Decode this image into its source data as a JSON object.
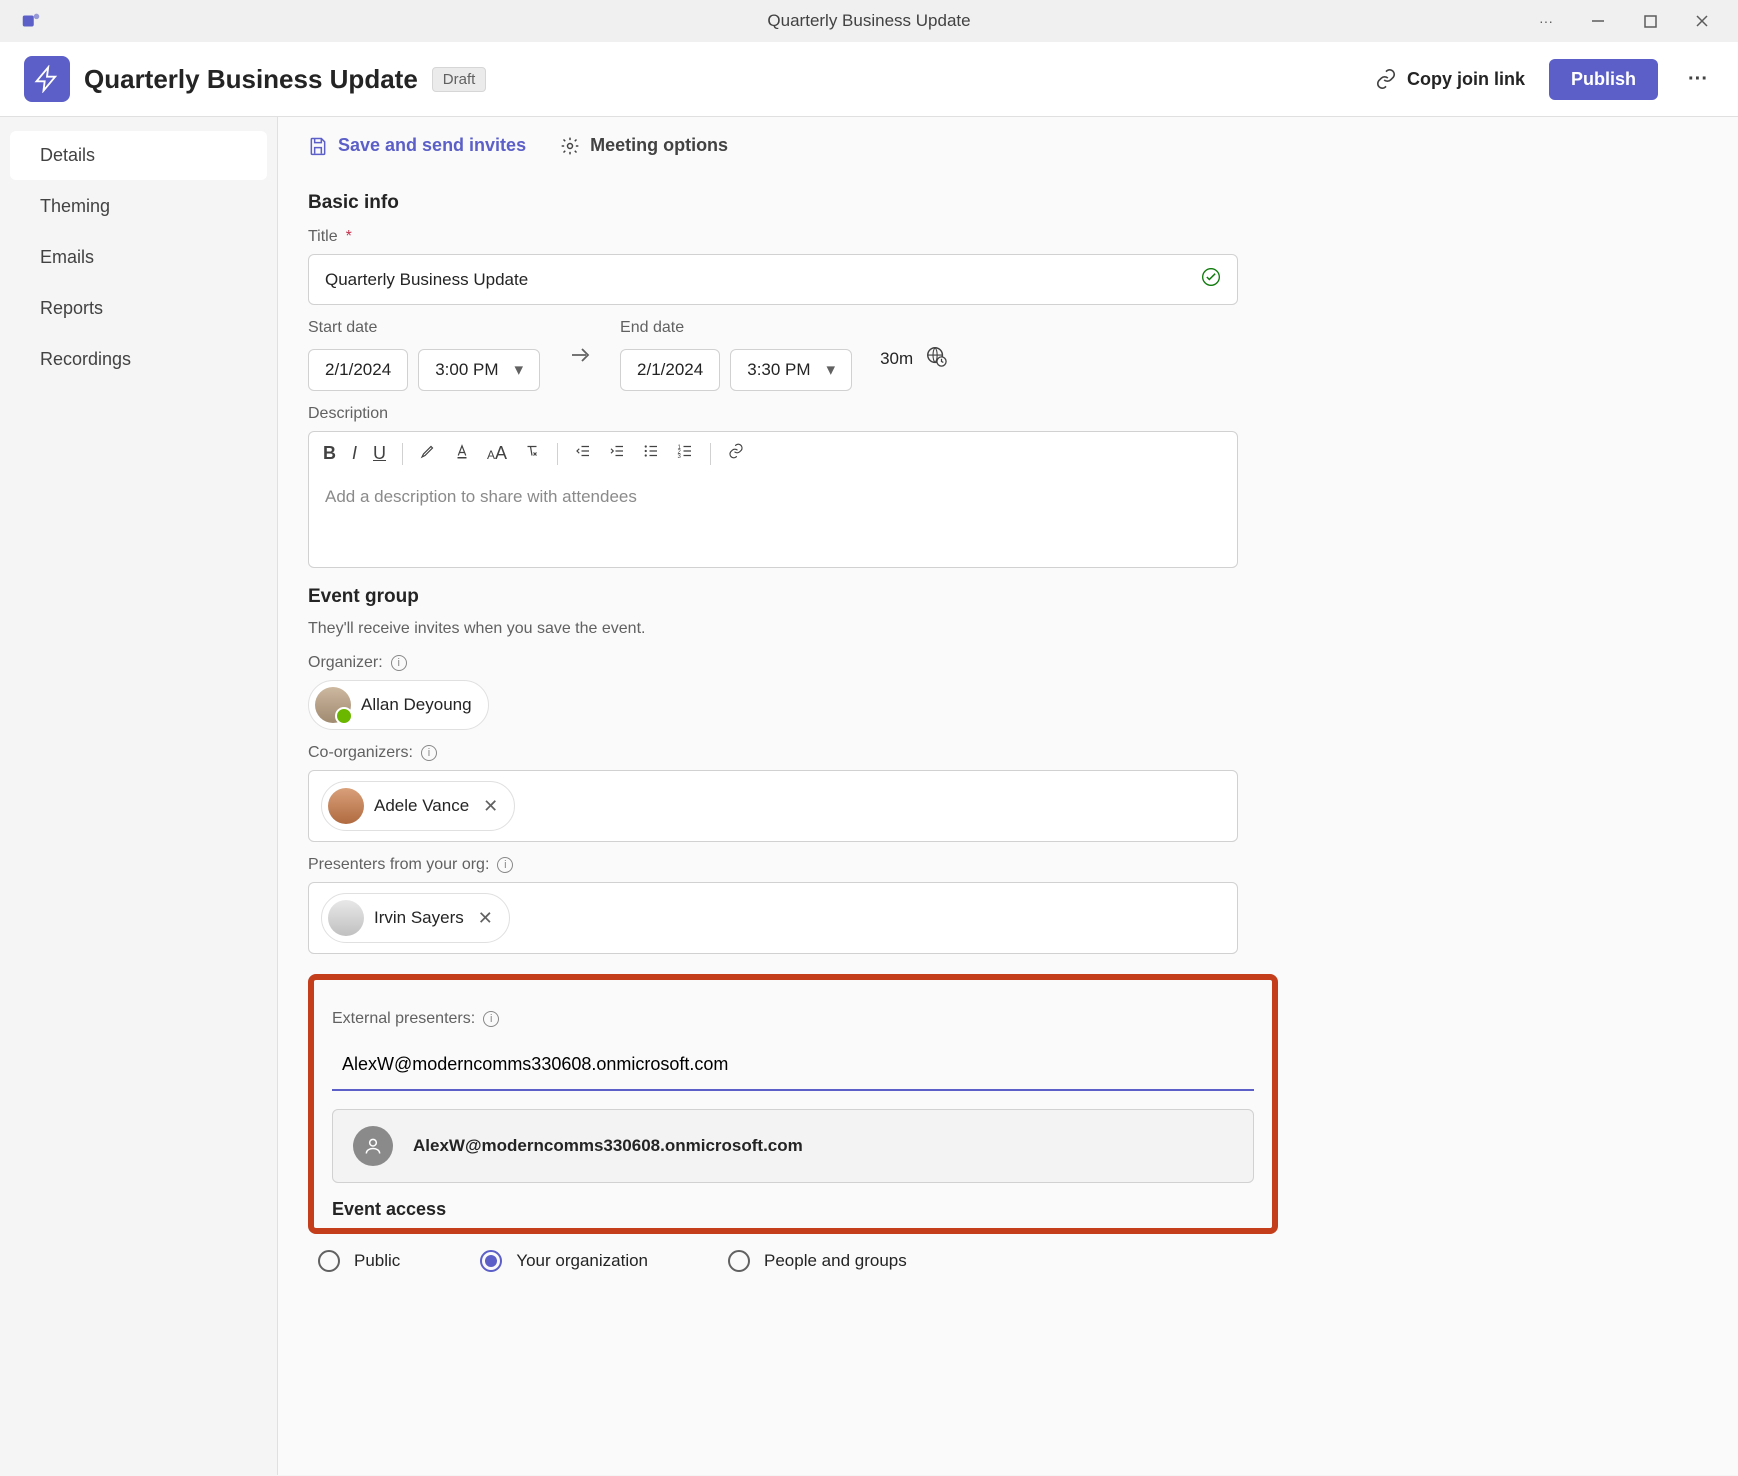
{
  "titlebar": {
    "title": "Quarterly Business Update"
  },
  "header": {
    "title": "Quarterly Business Update",
    "badge": "Draft",
    "copy_link": "Copy join link",
    "publish": "Publish"
  },
  "sidebar": {
    "items": [
      {
        "label": "Details",
        "active": true
      },
      {
        "label": "Theming"
      },
      {
        "label": "Emails"
      },
      {
        "label": "Reports"
      },
      {
        "label": "Recordings"
      }
    ]
  },
  "actions": {
    "save": "Save and send invites",
    "meeting_options": "Meeting options"
  },
  "form": {
    "basic_info_h": "Basic info",
    "title_label": "Title",
    "title_value": "Quarterly Business Update",
    "start_label": "Start date",
    "start_date": "2/1/2024",
    "start_time": "3:00 PM",
    "end_label": "End date",
    "end_date": "2/1/2024",
    "end_time": "3:30 PM",
    "duration": "30m",
    "description_label": "Description",
    "description_placeholder": "Add a description to share with attendees",
    "event_group_h": "Event group",
    "event_group_hint": "They'll receive invites when you save the event.",
    "organizer_label": "Organizer:",
    "organizer_name": "Allan Deyoung",
    "coorganizers_label": "Co-organizers:",
    "coorganizer_name": "Adele Vance",
    "presenters_label": "Presenters from your org:",
    "presenter_name": "Irvin Sayers",
    "external_label": "External presenters:",
    "external_input": "AlexW@moderncomms330608.onmicrosoft.com",
    "external_suggestion": "AlexW@moderncomms330608.onmicrosoft.com",
    "event_access_h": "Event access",
    "access_options": [
      {
        "label": "Public",
        "selected": false
      },
      {
        "label": "Your organization",
        "selected": true
      },
      {
        "label": "People and groups",
        "selected": false
      }
    ]
  }
}
